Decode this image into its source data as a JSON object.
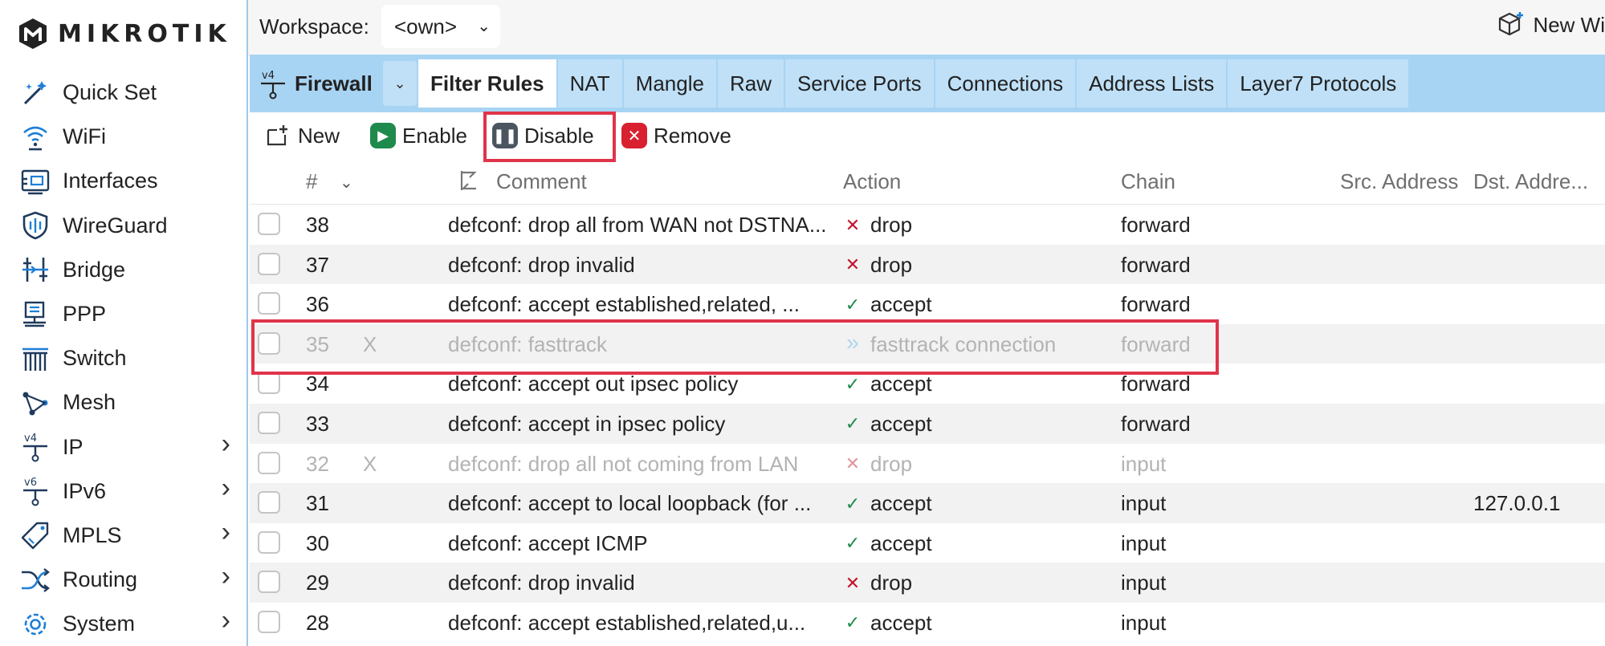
{
  "app": {
    "brand": "MIKROTIK"
  },
  "sidebar": {
    "items": [
      {
        "label": "Quick Set",
        "icon": "magic-wand-icon",
        "has_submenu": false
      },
      {
        "label": "WiFi",
        "icon": "wifi-icon",
        "has_submenu": false
      },
      {
        "label": "Interfaces",
        "icon": "interfaces-icon",
        "has_submenu": false
      },
      {
        "label": "WireGuard",
        "icon": "shield-icon",
        "has_submenu": false
      },
      {
        "label": "Bridge",
        "icon": "bridge-icon",
        "has_submenu": false
      },
      {
        "label": "PPP",
        "icon": "ppp-icon",
        "has_submenu": false
      },
      {
        "label": "Switch",
        "icon": "switch-icon",
        "has_submenu": false
      },
      {
        "label": "Mesh",
        "icon": "mesh-icon",
        "has_submenu": false
      },
      {
        "label": "IP",
        "icon": "ipv4-icon",
        "has_submenu": true
      },
      {
        "label": "IPv6",
        "icon": "ipv6-icon",
        "has_submenu": true
      },
      {
        "label": "MPLS",
        "icon": "tag-icon",
        "has_submenu": true
      },
      {
        "label": "Routing",
        "icon": "routing-icon",
        "has_submenu": true
      },
      {
        "label": "System",
        "icon": "gear-icon",
        "has_submenu": true
      }
    ]
  },
  "topbar": {
    "workspace_label": "Workspace:",
    "workspace_value": "<own>",
    "new_window_label": "New Wi"
  },
  "tabbar": {
    "section_badge": "v4",
    "section_title": "Firewall",
    "tabs": [
      "Filter Rules",
      "NAT",
      "Mangle",
      "Raw",
      "Service Ports",
      "Connections",
      "Address Lists",
      "Layer7 Protocols"
    ],
    "active_tab": "Filter Rules"
  },
  "toolbar": {
    "new_label": "New",
    "enable_label": "Enable",
    "disable_label": "Disable",
    "remove_label": "Remove"
  },
  "table": {
    "columns": {
      "num": "#",
      "comment": "Comment",
      "action": "Action",
      "chain": "Chain",
      "src": "Src. Address",
      "dst": "Dst. Addre..."
    },
    "rows": [
      {
        "num": "38",
        "flag": "",
        "comment": "defconf: drop all from WAN not DSTNA...",
        "action": "drop",
        "action_icon": "x-icon",
        "chain": "forward",
        "src": "",
        "dst": "",
        "disabled": false
      },
      {
        "num": "37",
        "flag": "",
        "comment": "defconf: drop invalid",
        "action": "drop",
        "action_icon": "x-icon",
        "chain": "forward",
        "src": "",
        "dst": "",
        "disabled": false
      },
      {
        "num": "36",
        "flag": "",
        "comment": "defconf: accept established,related, ...",
        "action": "accept",
        "action_icon": "check-icon",
        "chain": "forward",
        "src": "",
        "dst": "",
        "disabled": false
      },
      {
        "num": "35",
        "flag": "X",
        "comment": "defconf: fasttrack",
        "action": "fasttrack connection",
        "action_icon": "double-chevron-icon",
        "chain": "forward",
        "src": "",
        "dst": "",
        "disabled": true
      },
      {
        "num": "34",
        "flag": "",
        "comment": "defconf: accept out ipsec policy",
        "action": "accept",
        "action_icon": "check-icon",
        "chain": "forward",
        "src": "",
        "dst": "",
        "disabled": false
      },
      {
        "num": "33",
        "flag": "",
        "comment": "defconf: accept in ipsec policy",
        "action": "accept",
        "action_icon": "check-icon",
        "chain": "forward",
        "src": "",
        "dst": "",
        "disabled": false
      },
      {
        "num": "32",
        "flag": "X",
        "comment": "defconf: drop all not coming from LAN",
        "action": "drop",
        "action_icon": "x-icon",
        "chain": "input",
        "src": "",
        "dst": "",
        "disabled": true
      },
      {
        "num": "31",
        "flag": "",
        "comment": "defconf: accept to local loopback (for ...",
        "action": "accept",
        "action_icon": "check-icon",
        "chain": "input",
        "src": "",
        "dst": "127.0.0.1",
        "disabled": false
      },
      {
        "num": "30",
        "flag": "",
        "comment": "defconf: accept ICMP",
        "action": "accept",
        "action_icon": "check-icon",
        "chain": "input",
        "src": "",
        "dst": "",
        "disabled": false
      },
      {
        "num": "29",
        "flag": "",
        "comment": "defconf: drop invalid",
        "action": "drop",
        "action_icon": "x-icon",
        "chain": "input",
        "src": "",
        "dst": "",
        "disabled": false
      },
      {
        "num": "28",
        "flag": "",
        "comment": "defconf: accept established,related,u...",
        "action": "accept",
        "action_icon": "check-icon",
        "chain": "input",
        "src": "",
        "dst": "",
        "disabled": false
      }
    ]
  },
  "colors": {
    "accent_blue": "#a8d4f3",
    "highlight_red": "#e0344a",
    "accept_green": "#1e8a4c",
    "drop_red": "#c0152a",
    "fasttrack_blue": "#5ab0e6",
    "enable_green": "#1e8a4c",
    "remove_red": "#d8202f",
    "disable_gray": "#4a5560"
  }
}
